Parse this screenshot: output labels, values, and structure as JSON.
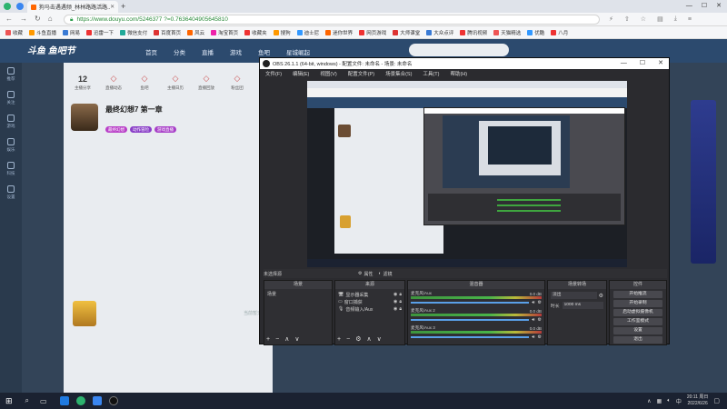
{
  "browser": {
    "tab_title": "狗马击遇遇频_林林路路活路...",
    "url": "https://www.douyu.com/5246377 ?=0.7636404905645810",
    "bookmarks": [
      "收藏",
      "斗鱼直播",
      "网易",
      "迅雷一下",
      "微信支付",
      "百度首页",
      "风云",
      "淘宝首页",
      "收藏夹",
      "搜狗",
      "迪士尼",
      "迷你世界",
      "网页游戏",
      "大师课堂",
      "大众点评",
      "腾讯视频",
      "天猫精选",
      "优酷",
      "八月"
    ],
    "bookmark_colors": [
      "#e55",
      "#f90",
      "#3a7bd5",
      "#e33",
      "#2a9",
      "#d33",
      "#f60",
      "#e2a",
      "#e33",
      "#f90",
      "#39f",
      "#f60",
      "#e33",
      "#d33",
      "#3a7bd5",
      "#e33",
      "#e55",
      "#39f",
      "#e33"
    ]
  },
  "site": {
    "logo": "斗鱼 鱼吧节",
    "nav": [
      "首页",
      "分类",
      "直播",
      "游戏",
      "鱼吧",
      "星城崛起"
    ],
    "stats": [
      {
        "num": "12",
        "label": "主播分享"
      },
      {
        "num": "",
        "label": "直播动态"
      },
      {
        "num": "",
        "label": "鱼吧"
      },
      {
        "num": "",
        "label": "主播日历"
      },
      {
        "num": "",
        "label": "直播回放"
      },
      {
        "num": "",
        "label": "粉丝团"
      }
    ],
    "room_title": "最终幻想7 第一章",
    "tags": [
      "最终幻想",
      "动作冒险",
      "游戏直播"
    ],
    "left_rail": [
      "推荐",
      "关注",
      "游戏",
      "娱乐",
      "科技",
      "设置"
    ],
    "tip_text": "当前暂无"
  },
  "obs": {
    "title": "OBS 26.1.1 (64-bit, windows) - 配置文件: 未命名 - 场景: 未命名",
    "menu": [
      "文件(F)",
      "编辑(E)",
      "视图(V)",
      "配置文件(P)",
      "场景集合(S)",
      "工具(T)",
      "帮助(H)"
    ],
    "filter_label": "未选择源",
    "props_btn": "属性",
    "filters_btn": "滤镜",
    "docks": {
      "scenes": {
        "title": "场景",
        "items": [
          "场景"
        ]
      },
      "sources": {
        "title": "来源",
        "items": [
          "显示器采集",
          "窗口捕获",
          "音频输入/Aux"
        ]
      },
      "mixer": {
        "title": "混音器",
        "channels": [
          {
            "name": "麦克风/Aux",
            "db": "0.0 dB"
          },
          {
            "name": "麦克风/Aux 2",
            "db": "0.0 dB"
          },
          {
            "name": "麦克风/Aux 3",
            "db": "0.0 dB"
          }
        ]
      },
      "transitions": {
        "title": "场景转场",
        "type": "淡出",
        "duration_label": "时长",
        "duration_value": "1000 ms"
      },
      "controls": {
        "title": "控件",
        "buttons": [
          "开始推流",
          "开始录制",
          "启动虚拟摄像机",
          "工作室模式",
          "设置",
          "退出"
        ]
      }
    }
  },
  "taskbar": {
    "time": "20:11 周日",
    "date": "2022/6/26",
    "tray_text": "中"
  }
}
